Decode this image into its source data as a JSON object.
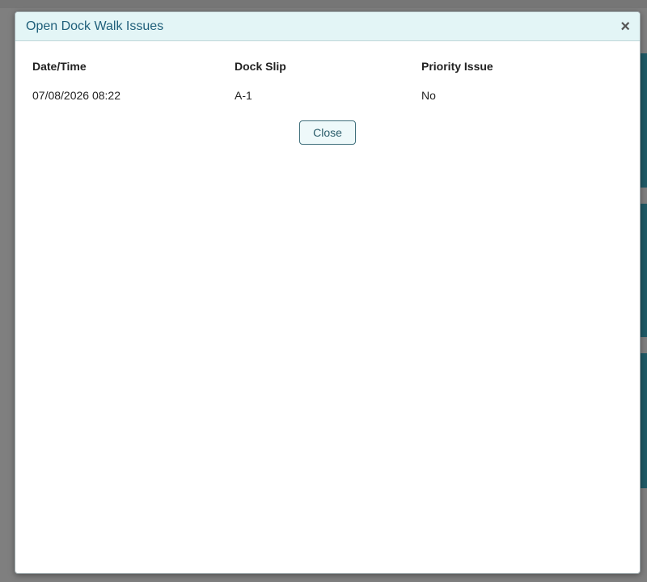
{
  "modal": {
    "title": "Open Dock Walk Issues",
    "close_icon": "close-icon",
    "close_glyph": "×",
    "table": {
      "columns": [
        "Date/Time",
        "Dock Slip",
        "Priority Issue"
      ],
      "rows": [
        [
          "07/08/2026 08:22",
          "A-1",
          "No"
        ]
      ]
    },
    "close_button_label": "Close"
  },
  "colors": {
    "header_bg": "#e3f5f6",
    "title_text": "#1f5f7a",
    "overlay": "#7f7f7f",
    "background_panel": "#1f5a66"
  }
}
